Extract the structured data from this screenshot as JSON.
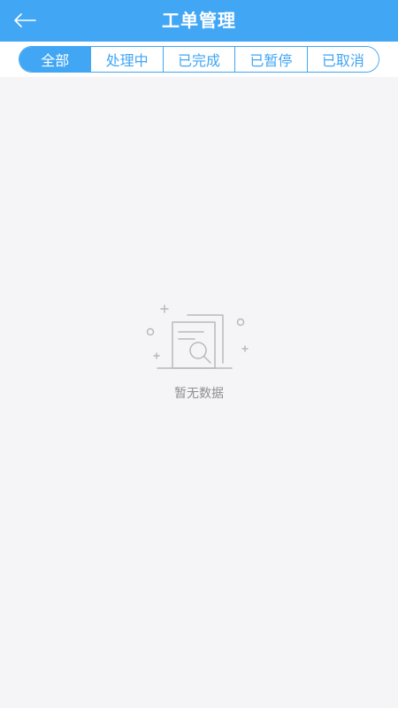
{
  "header": {
    "title": "工单管理",
    "back_icon": "back-arrow-icon"
  },
  "tabs": [
    {
      "label": "全部",
      "active": true
    },
    {
      "label": "处理中",
      "active": false
    },
    {
      "label": "已完成",
      "active": false
    },
    {
      "label": "已暂停",
      "active": false
    },
    {
      "label": "已取消",
      "active": false
    }
  ],
  "empty_state": {
    "icon": "no-data-document-search-icon",
    "text": "暂无数据"
  },
  "colors": {
    "primary": "#41a6f4",
    "background": "#f5f5f7",
    "muted_text": "#8f8f94"
  }
}
